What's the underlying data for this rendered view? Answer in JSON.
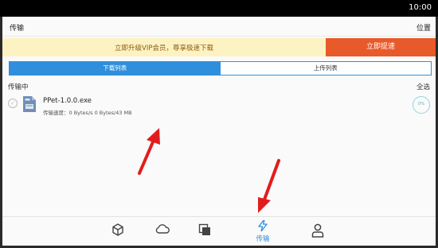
{
  "status_bar": {
    "time": "10:00"
  },
  "header": {
    "title": "传输",
    "right_label": "位置"
  },
  "vip_banner": {
    "text": "立即升级VIP会员，尊享极速下载",
    "button_label": "立即提速"
  },
  "tabs": [
    {
      "label": "下载列表",
      "active": true
    },
    {
      "label": "上传列表",
      "active": false
    }
  ],
  "section": {
    "title": "传输中",
    "select_all_label": "全选"
  },
  "transfers": [
    {
      "file_name": "PPet-1.0.0.exe",
      "speed_text": "传输速度：0 Bytes/s 0 Bytes/43 MB",
      "progress_text": "0%",
      "icon": "exe-file-icon"
    }
  ],
  "bottom_nav": [
    {
      "icon": "cube-icon",
      "label": ""
    },
    {
      "icon": "cloud-icon",
      "label": ""
    },
    {
      "icon": "stacked-squares-icon",
      "label": ""
    },
    {
      "icon": "lightning-icon",
      "label": "传输",
      "active": true
    },
    {
      "icon": "person-icon",
      "label": ""
    }
  ],
  "colors": {
    "accent": "#2f8fdd",
    "vip_banner_bg": "#fdf3c2",
    "vip_button": "#e95a2a",
    "annotation_arrow": "#e21c1c"
  }
}
